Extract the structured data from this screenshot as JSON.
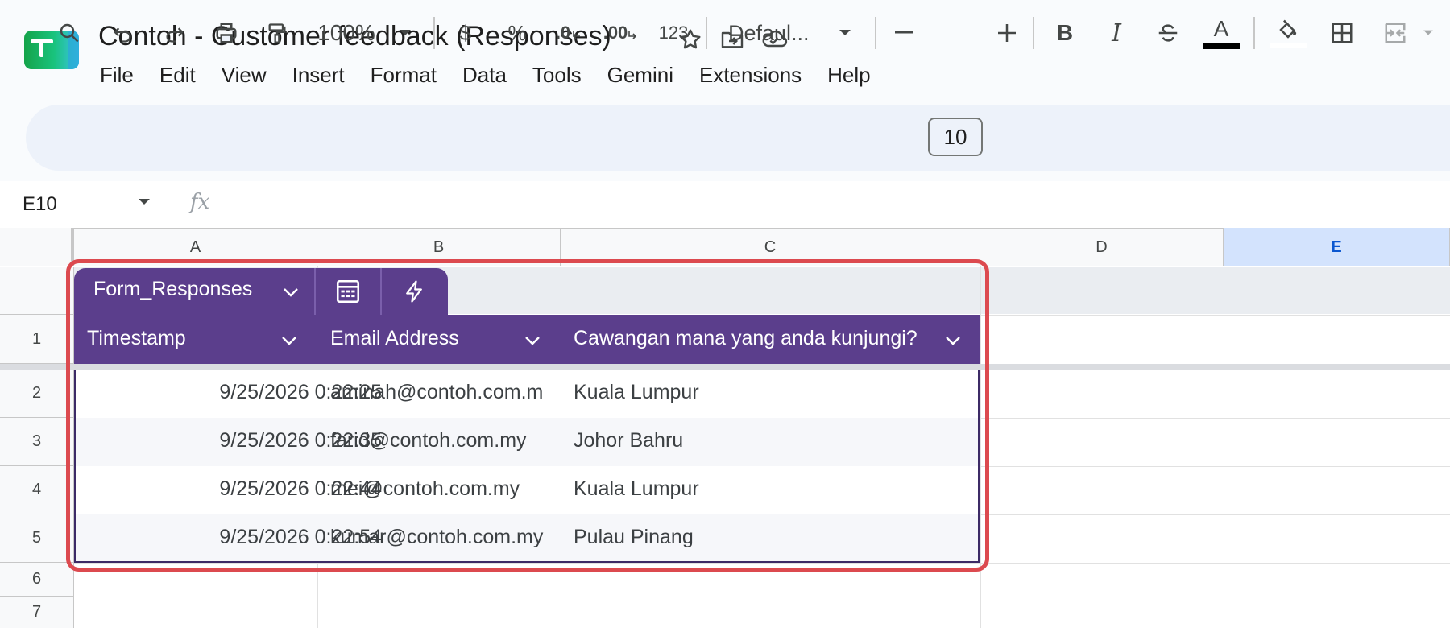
{
  "app": {
    "title": "Contoh - Customer feedback (Responses)",
    "title_icons": [
      "star-icon",
      "move-to-folder-icon",
      "cloud-saved-icon"
    ]
  },
  "menu": {
    "file": "File",
    "edit": "Edit",
    "view": "View",
    "insert": "Insert",
    "format": "Format",
    "data": "Data",
    "tools": "Tools",
    "gemini": "Gemini",
    "extensions": "Extensions",
    "help": "Help"
  },
  "toolbar": {
    "zoom": "100%",
    "currency": "$",
    "percent": "%",
    "dec_decrease": ".0",
    "dec_increase": ".00",
    "number_format": "123",
    "font": "Defaul...",
    "font_size": "10",
    "minus": "−",
    "plus": "+",
    "bold": "B",
    "italic": "I",
    "strike": "S",
    "text_color": "A",
    "text_color_swatch": "#000000",
    "fill_swatch": "#ffffff"
  },
  "formula_bar": {
    "name_box": "E10",
    "fx": "fx",
    "value": ""
  },
  "grid": {
    "columns": [
      "A",
      "B",
      "C",
      "D",
      "E"
    ],
    "selected_column": "E",
    "rows": [
      "1",
      "2",
      "3",
      "4",
      "5",
      "6",
      "7"
    ]
  },
  "table": {
    "name": "Form_Responses",
    "accent": "#5b3e8c",
    "headers": [
      "Timestamp",
      "Email Address",
      "Cawangan mana yang anda kunjungi?"
    ],
    "rows": [
      [
        "9/25/2026 0:22:25",
        "aminah@contoh.com.m",
        "Kuala Lumpur"
      ],
      [
        "9/25/2026 0:22:35",
        "farid@contoh.com.my",
        "Johor Bahru"
      ],
      [
        "9/25/2026 0:22:44",
        "mei@contoh.com.my",
        "Kuala Lumpur"
      ],
      [
        "9/25/2026 0:22:54",
        "kumar@contoh.com.my",
        "Pulau Pinang"
      ]
    ]
  },
  "highlight_color": "#dc4a4f"
}
